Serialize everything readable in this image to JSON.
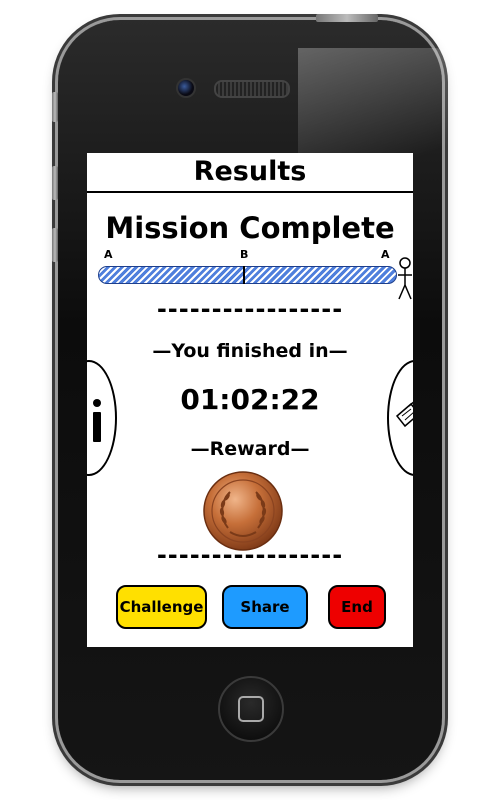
{
  "screen": {
    "title": "Results",
    "mission_status": "Mission Complete",
    "progress": {
      "start_label": "A",
      "mid_label": "B",
      "end_label": "A",
      "fill": 1.0
    },
    "divider_top": "-----------------",
    "finished_label": "You finished in",
    "time": "01:02:22",
    "reward_label": "Reward",
    "divider_bottom": "-----------------",
    "buttons": {
      "challenge": "Challenge",
      "share": "Share",
      "end": "End"
    },
    "colors": {
      "challenge": "#FFE000",
      "share": "#1E9BFF",
      "end": "#EE0000",
      "progress": "#4F7FDC",
      "medal": "#B8622E"
    },
    "icons": {
      "left": "info-icon",
      "right": "edit-note-icon",
      "medal": "bronze-medal-icon",
      "runner": "stick-figure-icon"
    }
  }
}
